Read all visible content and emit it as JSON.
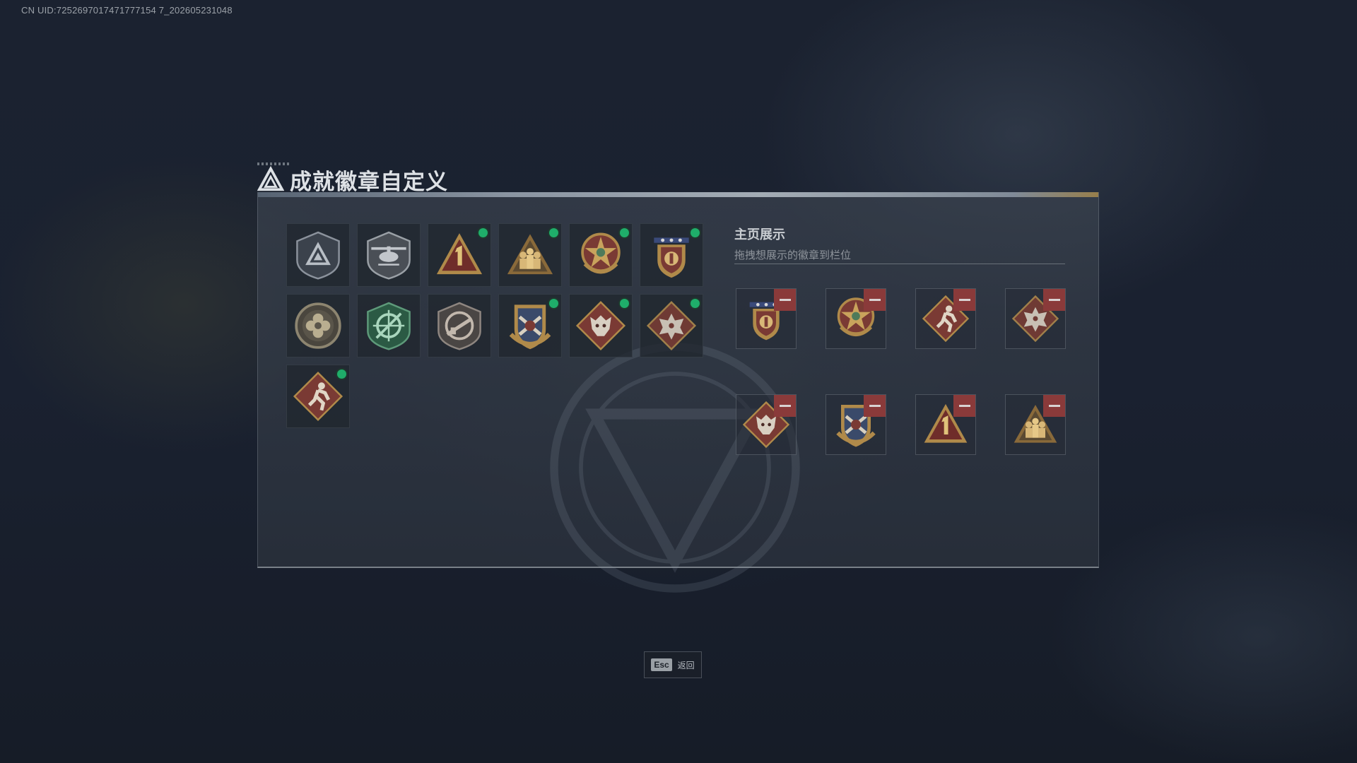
{
  "uid_text": "CN UID:7252697017471777154 7_202605231048",
  "title": "成就徽章自定义",
  "display": {
    "title": "主页展示",
    "subtitle": "拖拽想展示的徽章到栏位"
  },
  "badges": [
    {
      "name": "triangle-shield-badge",
      "new": false
    },
    {
      "name": "helicopter-shield-badge",
      "new": false
    },
    {
      "name": "number-one-badge",
      "new": true
    },
    {
      "name": "soldier-squad-badge",
      "new": true
    },
    {
      "name": "star-medal-badge",
      "new": true
    },
    {
      "name": "star-shield-badge",
      "new": true
    },
    {
      "name": "flower-emblem-badge",
      "new": false
    },
    {
      "name": "green-crosshair-badge",
      "new": false
    },
    {
      "name": "rifle-shield-badge",
      "new": false
    },
    {
      "name": "crossed-rifles-badge",
      "new": true
    },
    {
      "name": "wolf-head-badge",
      "new": true
    },
    {
      "name": "dragon-head-badge",
      "new": true
    },
    {
      "name": "runner-badge",
      "new": true
    }
  ],
  "display_slots": [
    {
      "name": "star-shield-badge"
    },
    {
      "name": "star-medal-badge"
    },
    {
      "name": "runner-badge"
    },
    {
      "name": "dragon-head-badge"
    },
    {
      "name": "wolf-head-badge"
    },
    {
      "name": "crossed-rifles-badge"
    },
    {
      "name": "number-one-badge"
    },
    {
      "name": "soldier-squad-badge"
    }
  ],
  "esc": {
    "key": "Esc",
    "label": "返回"
  },
  "colors": {
    "new_dot": "#1fae6a",
    "remove": "#8a3a3a",
    "gold": "#b08a4a",
    "maroon": "#7a3a34"
  }
}
